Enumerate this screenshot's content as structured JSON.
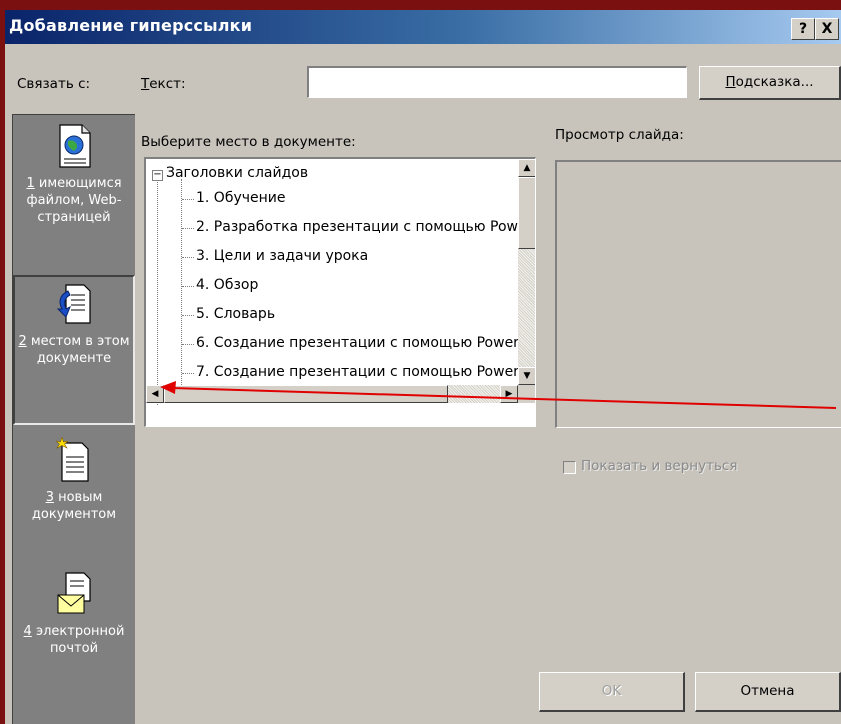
{
  "dialog": {
    "title": "Добавление гиперссылки",
    "help_button": "?",
    "close_button": "X"
  },
  "link_to_label": "Связать с:",
  "text_label": "Текст:",
  "text_value": "",
  "hint_button": "Подсказка...",
  "places": [
    {
      "number": "1",
      "label_rest": " имеющимся файлом, Web-страницей",
      "icon": "web-page-icon"
    },
    {
      "number": "2",
      "label_rest": " местом в этом документе",
      "icon": "document-place-icon"
    },
    {
      "number": "3",
      "label_rest": " новым документом",
      "icon": "new-document-icon"
    },
    {
      "number": "4",
      "label_rest": " электронной почтой",
      "icon": "email-icon"
    }
  ],
  "select_place_label": "Выберите место в документе:",
  "tree": {
    "root": "Заголовки слайдов",
    "items": [
      "1. Обучение",
      "2.  Разработка презентации с помощью Pow",
      "3. Цели и задачи урока",
      "4. Обзор",
      "5. Словарь",
      "6. Создание презентации с помощью Power",
      "7. Создание презентации с помощью Power"
    ]
  },
  "preview_label": "Просмотр слайда:",
  "show_and_return_label": "Показать и вернуться",
  "ok_button": "OK",
  "cancel_button": "Отмена",
  "colors": {
    "background": "#7a1010",
    "title_gradient_start": "#0a246a",
    "annotation_arrow": "#e00000"
  }
}
